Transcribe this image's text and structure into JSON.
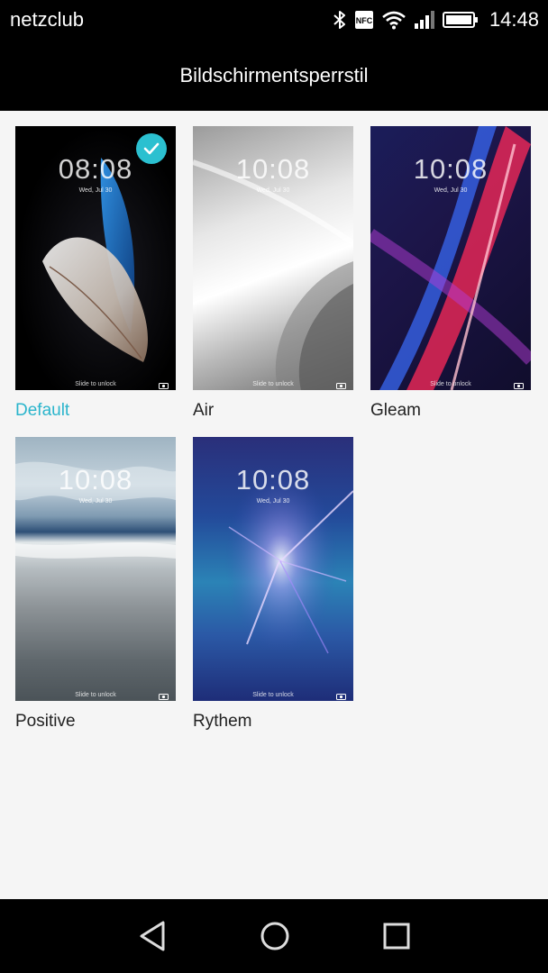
{
  "status_bar": {
    "carrier": "netzclub",
    "time": "14:48",
    "icons": [
      "bluetooth-icon",
      "nfc-icon",
      "wifi-icon",
      "signal-icon",
      "battery-icon"
    ],
    "nfc_label": "NFC"
  },
  "header": {
    "title": "Bildschirmentsperrstil"
  },
  "styles": [
    {
      "label": "Default",
      "time": "08:08",
      "date": "Wed, Jul 30",
      "slide": "Slide to unlock",
      "selected": true
    },
    {
      "label": "Air",
      "time": "10:08",
      "date": "Wed, Jul 30",
      "slide": "Slide to unlock",
      "selected": false
    },
    {
      "label": "Gleam",
      "time": "10:08",
      "date": "Wed, Jul 30",
      "slide": "Slide to unlock",
      "selected": false
    },
    {
      "label": "Positive",
      "time": "10:08",
      "date": "Wed, Jul 30",
      "slide": "Slide to unlock",
      "selected": false
    },
    {
      "label": "Rythem",
      "time": "10:08",
      "date": "Wed, Jul 30",
      "slide": "Slide to unlock",
      "selected": false
    }
  ],
  "colors": {
    "accent": "#2bb5cc",
    "bar_background": "#000000",
    "content_background": "#f5f5f5"
  },
  "nav_bar": {
    "icons": [
      "back-icon",
      "home-icon",
      "recents-icon"
    ]
  }
}
